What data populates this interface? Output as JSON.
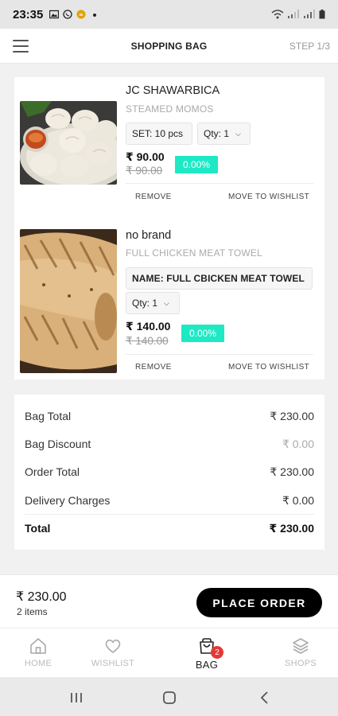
{
  "status_bar": {
    "time": "23:35"
  },
  "header": {
    "title": "SHOPPING BAG",
    "step": "STEP 1/3"
  },
  "items": [
    {
      "brand": "JC SHAWARBICA",
      "name": "STEAMED MOMOS",
      "variant": "SET: 10 pcs",
      "qty": "Qty: 1",
      "price": "₹ 90.00",
      "mrp": "₹ 90.00",
      "discount": "0.00%",
      "remove_label": "REMOVE",
      "wishlist_label": "MOVE TO WISHLIST"
    },
    {
      "brand": "no brand",
      "name": "FULL CHICKEN MEAT TOWEL",
      "variant": "NAME: FULL CBICKEN MEAT TOWEL",
      "qty": "Qty: 1",
      "price": "₹ 140.00",
      "mrp": "₹ 140.00",
      "discount": "0.00%",
      "remove_label": "REMOVE",
      "wishlist_label": "MOVE TO WISHLIST"
    }
  ],
  "totals": {
    "bag_total_label": "Bag Total",
    "bag_total": "₹ 230.00",
    "bag_discount_label": "Bag Discount",
    "bag_discount": "₹ 0.00",
    "order_total_label": "Order Total",
    "order_total": "₹ 230.00",
    "delivery_label": "Delivery Charges",
    "delivery": "₹ 0.00",
    "total_label": "Total",
    "total": "₹ 230.00"
  },
  "order_bar": {
    "amount": "₹ 230.00",
    "count": "2 items",
    "button": "PLACE ORDER"
  },
  "bottom_nav": {
    "items": [
      {
        "label": "HOME",
        "icon": "home-icon"
      },
      {
        "label": "WISHLIST",
        "icon": "heart-icon"
      },
      {
        "label": "BAG",
        "icon": "bag-icon",
        "badge": "2"
      },
      {
        "label": "SHOPS",
        "icon": "layers-icon"
      }
    ]
  },
  "colors": {
    "discount_badge": "#1de9c4",
    "cart_badge": "#e53935",
    "primary_button": "#000000"
  }
}
